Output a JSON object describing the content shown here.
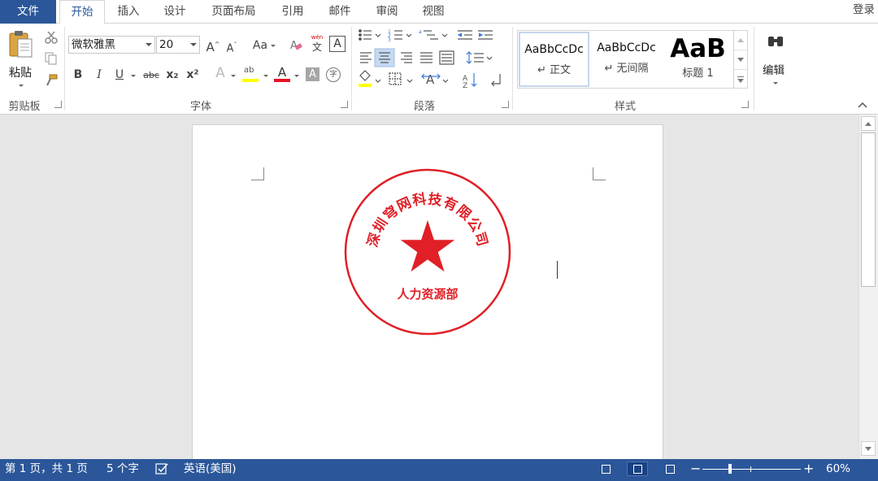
{
  "app": {
    "login": "登录"
  },
  "tabs": [
    {
      "label": "文件"
    },
    {
      "label": "开始"
    },
    {
      "label": "插入"
    },
    {
      "label": "设计"
    },
    {
      "label": "页面布局"
    },
    {
      "label": "引用"
    },
    {
      "label": "邮件"
    },
    {
      "label": "审阅"
    },
    {
      "label": "视图"
    }
  ],
  "ribbon": {
    "clipboard": {
      "label": "剪贴板",
      "paste_label": "粘贴"
    },
    "font": {
      "label": "字体",
      "font_name": "微软雅黑",
      "font_size": "20",
      "grow_glyph": "A",
      "shrink_glyph": "A",
      "case_glyph": "Aa",
      "bold": "B",
      "italic": "I",
      "underline": "U",
      "strike": "abc",
      "subscript": "x₂",
      "superscript": "x²",
      "phonetic_top": "wén",
      "phonetic_bottom": "文",
      "border_char": "A",
      "effects_glyph": "A",
      "highlight_glyph": "ab",
      "font_color_glyph": "A",
      "shading_glyph": "A",
      "enclose_glyph": "字",
      "highlight_color": "#ffff00",
      "font_color": "#e81123"
    },
    "paragraph": {
      "label": "段落"
    },
    "styles": {
      "label": "样式",
      "items": [
        {
          "sample": "AaBbCcDc",
          "name": "正文"
        },
        {
          "sample": "AaBbCcDc",
          "name": "无间隔"
        },
        {
          "sample": "AaB",
          "name": "标题 1"
        }
      ]
    },
    "editing": {
      "label": "编辑"
    }
  },
  "document": {
    "stamp": {
      "company": "深圳穹网科技有限公司",
      "department": "人力资源部",
      "color": "#e01f26"
    }
  },
  "statusbar": {
    "page": "第 1 页，共 1 页",
    "words": "5 个字",
    "language": "英语(美国)",
    "zoom_minus": "−",
    "zoom_plus": "+",
    "zoom": "60%",
    "zoom_level": 0.6,
    "bg_color": "#2b579a"
  }
}
